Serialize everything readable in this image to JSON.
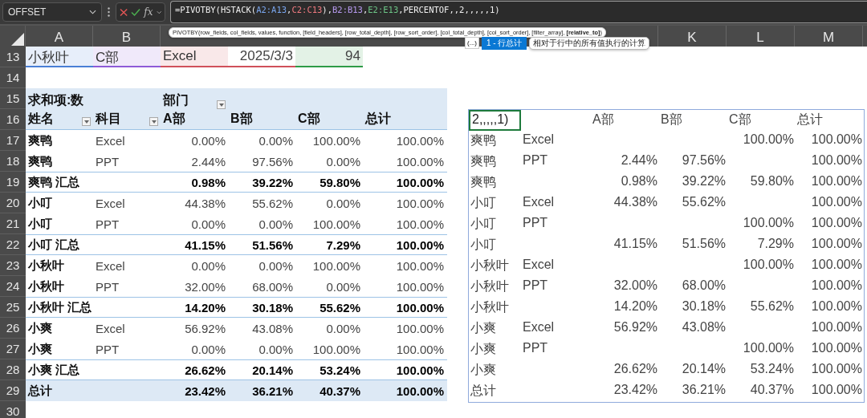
{
  "name_box": "OFFSET",
  "function_button": "fx",
  "formula": [
    {
      "text": "=PIVOTBY(HSTACK("
    },
    {
      "text": "A2:A13",
      "color": "#7aa7f0"
    },
    {
      "text": ","
    },
    {
      "text": "C2:C13",
      "color": "#f07a80"
    },
    {
      "text": "),"
    },
    {
      "text": "B2:B13",
      "color": "#b79af0"
    },
    {
      "text": ","
    },
    {
      "text": "E2:E13",
      "color": "#6cc486"
    },
    {
      "text": ",PERCENTOF,,2,,,,,1)"
    }
  ],
  "column_headers_left": [
    "A",
    "B"
  ],
  "column_headers_right": [
    "K",
    "L",
    "M"
  ],
  "function_tooltip": "PIVOTBY(row_fields, col_fields, values, function, [field_headers], [row_total_depth], [row_sort_order], [col_total_depth], [col_sort_order], [filter_array], **[relative_to]**)",
  "autocomplete": {
    "more": "(...)",
    "items": [
      {
        "label": "1 - 行总计",
        "selected": true
      }
    ],
    "description": "相对于行中的所有值执行的计算"
  },
  "row_numbers": [
    "13",
    "14",
    "15",
    "16",
    "17",
    "18",
    "19",
    "20",
    "21",
    "22",
    "23",
    "24",
    "25",
    "26",
    "27",
    "28",
    "29",
    "30"
  ],
  "row_13": [
    {
      "text": "小秋叶",
      "color": "#4a7fd6"
    },
    {
      "text": "C部",
      "color": "#8e5bd8"
    },
    {
      "text": "Excel",
      "color": "#d0505a"
    },
    {
      "text": "2025/3/3"
    },
    {
      "text": "94",
      "color": "#2e9b47"
    }
  ],
  "pivot": {
    "corner": "求和项:数",
    "column_field": "部门",
    "row_fields": [
      "姓名",
      "科目"
    ],
    "columns": [
      "A部",
      "B部",
      "C部",
      "总计"
    ],
    "rows": [
      {
        "kind": "detail",
        "name": "爽鸭",
        "subject": "Excel",
        "values": [
          "0.00%",
          "0.00%",
          "100.00%",
          "100.00%"
        ]
      },
      {
        "kind": "detail",
        "name": "爽鸭",
        "subject": "PPT",
        "values": [
          "2.44%",
          "97.56%",
          "0.00%",
          "100.00%"
        ]
      },
      {
        "kind": "subtotal",
        "name": "爽鸭 汇总",
        "values": [
          "0.98%",
          "39.22%",
          "59.80%",
          "100.00%"
        ]
      },
      {
        "kind": "detail",
        "name": "小叮",
        "subject": "Excel",
        "values": [
          "44.38%",
          "55.62%",
          "0.00%",
          "100.00%"
        ]
      },
      {
        "kind": "detail",
        "name": "小叮",
        "subject": "PPT",
        "values": [
          "0.00%",
          "0.00%",
          "100.00%",
          "100.00%"
        ]
      },
      {
        "kind": "subtotal",
        "name": "小叮 汇总",
        "values": [
          "41.15%",
          "51.56%",
          "7.29%",
          "100.00%"
        ]
      },
      {
        "kind": "detail",
        "name": "小秋叶",
        "subject": "Excel",
        "values": [
          "0.00%",
          "0.00%",
          "100.00%",
          "100.00%"
        ]
      },
      {
        "kind": "detail",
        "name": "小秋叶",
        "subject": "PPT",
        "values": [
          "32.00%",
          "68.00%",
          "0.00%",
          "100.00%"
        ]
      },
      {
        "kind": "subtotal",
        "name": "小秋叶 汇总",
        "values": [
          "14.20%",
          "30.18%",
          "55.62%",
          "100.00%"
        ]
      },
      {
        "kind": "detail",
        "name": "小爽",
        "subject": "Excel",
        "values": [
          "56.92%",
          "43.08%",
          "0.00%",
          "100.00%"
        ]
      },
      {
        "kind": "detail",
        "name": "小爽",
        "subject": "PPT",
        "values": [
          "0.00%",
          "0.00%",
          "100.00%",
          "100.00%"
        ]
      },
      {
        "kind": "subtotal",
        "name": "小爽 汇总",
        "values": [
          "26.62%",
          "20.14%",
          "53.24%",
          "100.00%"
        ]
      },
      {
        "kind": "grand_total",
        "name": "总计",
        "values": [
          "23.42%",
          "36.21%",
          "40.37%",
          "100.00%"
        ]
      }
    ]
  },
  "result": {
    "active_cell": "2,,,,,1)",
    "columns": [
      "A部",
      "B部",
      "C部",
      "总计"
    ],
    "rows": [
      [
        "爽鸭",
        "Excel",
        null,
        null,
        "100.00%",
        "100.00%"
      ],
      [
        "爽鸭",
        "PPT",
        "2.44%",
        "97.56%",
        null,
        "100.00%"
      ],
      [
        "爽鸭",
        null,
        "0.98%",
        "39.22%",
        "59.80%",
        "100.00%"
      ],
      [
        "小叮",
        "Excel",
        "44.38%",
        "55.62%",
        null,
        "100.00%"
      ],
      [
        "小叮",
        "PPT",
        null,
        null,
        "100.00%",
        "100.00%"
      ],
      [
        "小叮",
        null,
        "41.15%",
        "51.56%",
        "7.29%",
        "100.00%"
      ],
      [
        "小秋叶",
        "Excel",
        null,
        null,
        "100.00%",
        "100.00%"
      ],
      [
        "小秋叶",
        "PPT",
        "32.00%",
        "68.00%",
        null,
        "100.00%"
      ],
      [
        "小秋叶",
        null,
        "14.20%",
        "30.18%",
        "55.62%",
        "100.00%"
      ],
      [
        "小爽",
        "Excel",
        "56.92%",
        "43.08%",
        null,
        "100.00%"
      ],
      [
        "小爽",
        "PPT",
        null,
        null,
        "100.00%",
        "100.00%"
      ],
      [
        "小爽",
        null,
        "26.62%",
        "20.14%",
        "53.24%",
        "100.00%"
      ],
      [
        "总计",
        null,
        "23.42%",
        "36.21%",
        "40.37%",
        "100.00%"
      ]
    ]
  }
}
